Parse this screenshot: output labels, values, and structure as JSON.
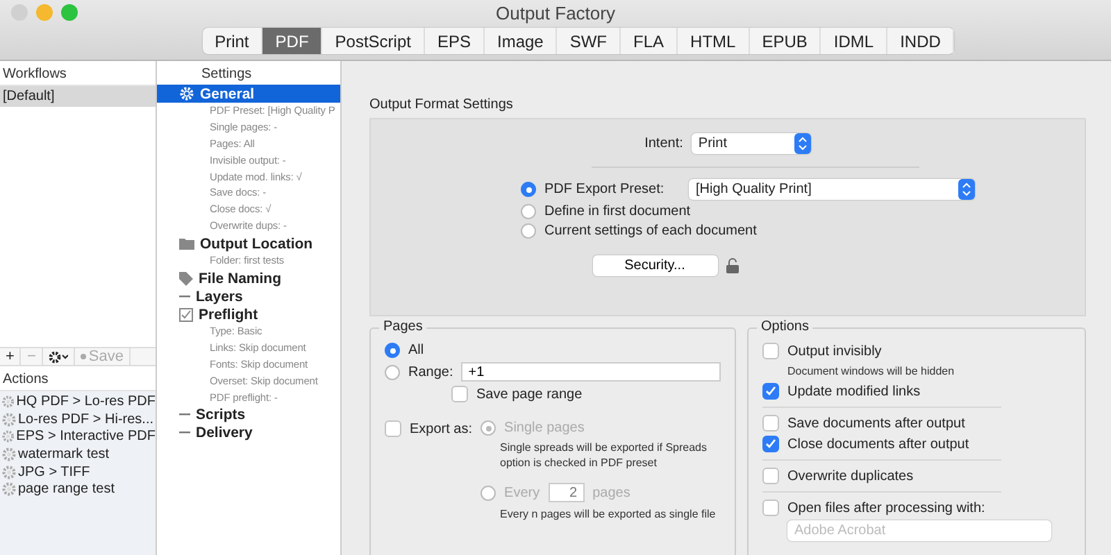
{
  "window": {
    "title": "Output Factory"
  },
  "tabs": [
    {
      "label": "Print",
      "selected": false
    },
    {
      "label": "PDF",
      "selected": true
    },
    {
      "label": "PostScript",
      "selected": false
    },
    {
      "label": "EPS",
      "selected": false
    },
    {
      "label": "Image",
      "selected": false
    },
    {
      "label": "SWF",
      "selected": false
    },
    {
      "label": "FLA",
      "selected": false
    },
    {
      "label": "HTML",
      "selected": false
    },
    {
      "label": "EPUB",
      "selected": false
    },
    {
      "label": "IDML",
      "selected": false
    },
    {
      "label": "INDD",
      "selected": false
    }
  ],
  "workflows": {
    "header": "Workflows",
    "items": [
      {
        "label": "[Default]",
        "selected": true
      }
    ],
    "toolbar": {
      "add": "+",
      "remove": "−",
      "save": "Save"
    }
  },
  "actions": {
    "header": "Actions",
    "items": [
      "HQ PDF > Lo-res PDF",
      "Lo-res PDF > Hi-res...",
      "EPS > Interactive PDF",
      "watermark test",
      "JPG > TIFF",
      "page range test"
    ]
  },
  "settings": {
    "header": "Settings",
    "items": [
      {
        "kind": "gear",
        "label": "General",
        "selected": true,
        "details": [
          "PDF Preset: [High Quality P",
          "Single pages: -",
          "Pages: All",
          "Invisible output: -",
          "Update mod. links: √",
          "Save docs: -",
          "Close docs: √",
          "Overwrite dups: -"
        ]
      },
      {
        "kind": "folder",
        "label": "Output Location",
        "selected": false,
        "details": [
          "Folder: first tests"
        ]
      },
      {
        "kind": "tag",
        "label": "File Naming",
        "selected": false
      },
      {
        "kind": "dash",
        "label": "Layers",
        "selected": false
      },
      {
        "kind": "check",
        "label": "Preflight",
        "selected": false,
        "details": [
          "Type: Basic",
          "Links: Skip document",
          "Fonts: Skip document",
          "Overset: Skip document",
          "PDF preflight: -"
        ]
      },
      {
        "kind": "dash",
        "label": "Scripts",
        "selected": false
      },
      {
        "kind": "dash",
        "label": "Delivery",
        "selected": false
      }
    ]
  },
  "output_format": {
    "title": "Output Format Settings",
    "intent_label": "Intent:",
    "intent": "Print",
    "sources": [
      {
        "label": "PDF Export Preset:",
        "selected": true,
        "value": "[High Quality Print]"
      },
      {
        "label": "Define in first document",
        "selected": false
      },
      {
        "label": "Current settings of each document",
        "selected": false
      }
    ],
    "security_button": "Security..."
  },
  "pages": {
    "title": "Pages",
    "all": {
      "label": "All",
      "selected": true
    },
    "range": {
      "label": "Range:",
      "selected": false,
      "value": "+1"
    },
    "save_range": {
      "label": "Save page range",
      "checked": false
    },
    "export_as": {
      "label": "Export as:",
      "checked": false,
      "single": {
        "label": "Single pages",
        "selected": true,
        "note": "Single spreads will be exported if Spreads option is checked in PDF preset"
      },
      "every": {
        "label": "Every",
        "selected": false,
        "value": "2",
        "unit": "pages",
        "note": "Every n pages will be exported as single file"
      }
    }
  },
  "options": {
    "title": "Options",
    "groups": [
      [
        {
          "label": "Output invisibly",
          "checked": false,
          "note": "Document windows will be hidden"
        },
        {
          "label": "Update modified links",
          "checked": true
        }
      ],
      [
        {
          "label": "Save documents after output",
          "checked": false
        },
        {
          "label": "Close documents after output",
          "checked": true
        }
      ],
      [
        {
          "label": "Overwrite duplicates",
          "checked": false
        }
      ],
      [
        {
          "label": "Open files after processing with:",
          "checked": false
        }
      ]
    ],
    "app": "Adobe Acrobat"
  }
}
